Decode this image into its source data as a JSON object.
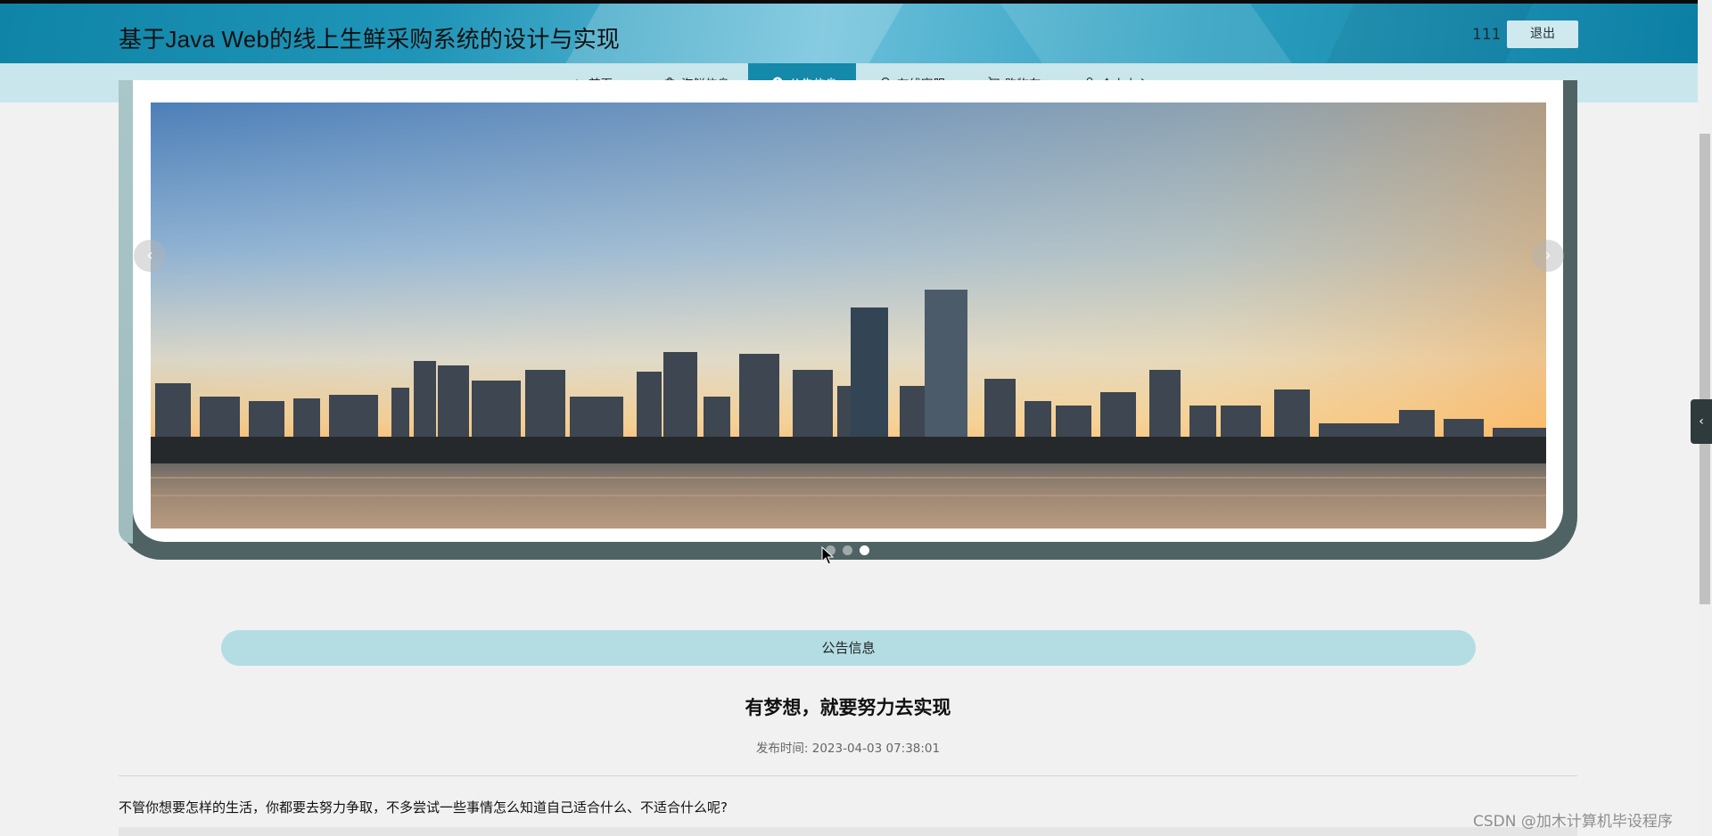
{
  "header": {
    "title": "基于Java Web的线上生鲜采购系统的设计与实现",
    "username": "111",
    "logout_label": "退出"
  },
  "nav": {
    "items": [
      {
        "label": "首页",
        "icon": "star-icon",
        "active": false
      },
      {
        "label": "海鲜信息",
        "icon": "bag-icon",
        "active": false
      },
      {
        "label": "公告信息",
        "icon": "info-icon",
        "active": true
      },
      {
        "label": "在线客服",
        "icon": "headset-icon",
        "active": false
      },
      {
        "label": "购物车",
        "icon": "cart-icon",
        "active": false
      },
      {
        "label": "个人中心",
        "icon": "user-icon",
        "active": false
      }
    ]
  },
  "carousel": {
    "prev_icon": "chevron-left-icon",
    "next_icon": "chevron-right-icon",
    "slide_count": 3,
    "active_index": 2
  },
  "notice": {
    "section_label": "公告信息",
    "title": "有梦想，就要努力去实现",
    "publish_label": "发布时间:",
    "publish_time": "2023-04-03 07:38:01",
    "paragraph": "不管你想要怎样的生活，你都要去努力争取，不多尝试一些事情怎么知道自己适合什么、不适合什么呢?"
  },
  "side_tab_icon": "chevron-left-icon",
  "watermark": "CSDN @加木计算机毕设程序",
  "colors": {
    "header_blue": "#1589a9",
    "nav_bg": "#c9e6ec",
    "section_bar": "#b3dde3",
    "page_bg": "#f2f1f1"
  }
}
